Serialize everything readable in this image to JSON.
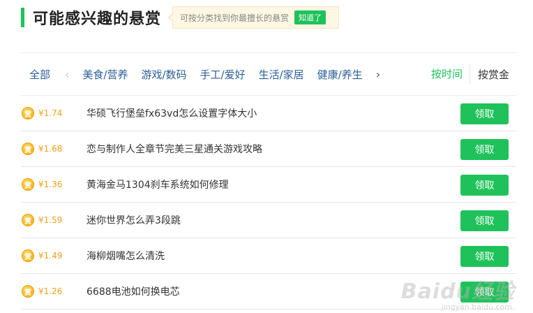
{
  "header": {
    "title": "可能感兴趣的悬赏",
    "tip_text": "可按分类找到你最擅长的悬赏",
    "tip_button": "知道了"
  },
  "categories": {
    "all": "全部",
    "prev_icon": "chevron-left",
    "items": [
      "美食/营养",
      "游戏/数码",
      "手工/爱好",
      "生活/家居",
      "健康/养生"
    ],
    "next_icon": "chevron-right"
  },
  "sort": {
    "by_time": "按时间",
    "by_reward": "按赏金"
  },
  "questions": [
    {
      "badge": "赏",
      "reward": "¥1.74",
      "title": "华硕飞行堡垒fx63vd怎么设置字体大小",
      "action": "领取"
    },
    {
      "badge": "赏",
      "reward": "¥1.68",
      "title": "恋与制作人全章节完美三星通关游戏攻略",
      "action": "领取"
    },
    {
      "badge": "赏",
      "reward": "¥1.36",
      "title": "黄海金马1304刹车系统如何修理",
      "action": "领取"
    },
    {
      "badge": "赏",
      "reward": "¥1.59",
      "title": "迷你世界怎么弄3段跳",
      "action": "领取"
    },
    {
      "badge": "赏",
      "reward": "¥1.49",
      "title": "海柳烟嘴怎么清洗",
      "action": "领取"
    },
    {
      "badge": "赏",
      "reward": "¥1.26",
      "title": "6688电池如何换电芯",
      "action": "领取"
    }
  ],
  "watermark": {
    "logo": "Baidu经验",
    "url": "jingyan.baidu.com"
  },
  "colors": {
    "accent": "#1fc25a",
    "link": "#2c5e97",
    "reward": "#f0a01c",
    "tip_bg": "#fdf7e3"
  }
}
